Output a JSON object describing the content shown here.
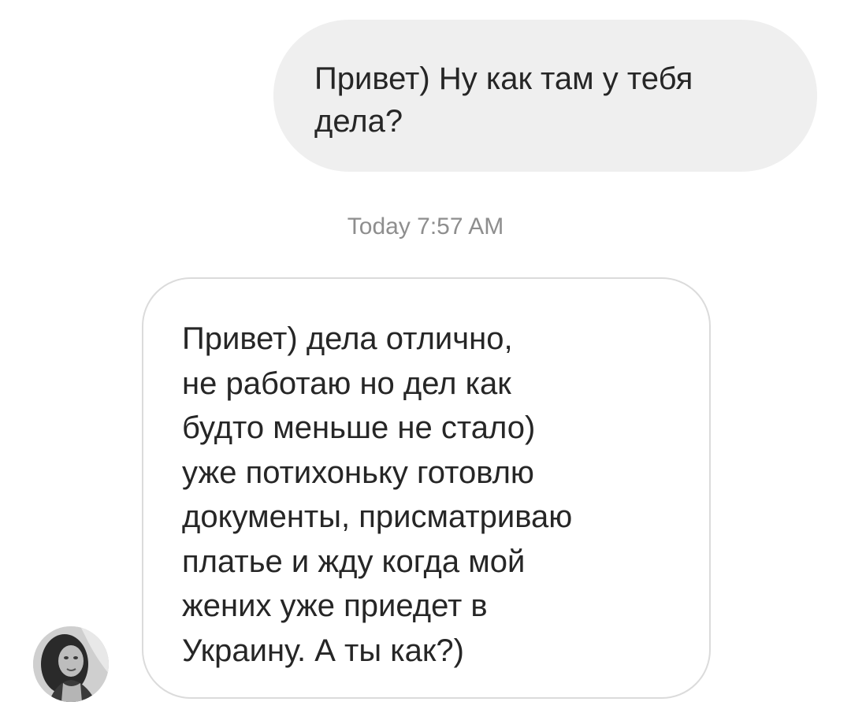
{
  "conversation": {
    "messages": [
      {
        "direction": "sent",
        "text": "Привет) Ну как там у тебя\nдела?"
      },
      {
        "direction": "received",
        "text": "Привет) дела отлично,\nне работаю но дел как\nбудто меньше не стало)\nуже потихоньку готовлю\nдокументы, присматриваю\nплатье и жду когда мой\nжених уже приедет в\nУкраину. А ты как?)"
      }
    ],
    "timestamp": "Today 7:57 AM"
  },
  "contact": {
    "avatar_icon": "profile-photo-avatar"
  },
  "colors": {
    "sent_bubble_bg": "#efefef",
    "received_bubble_border": "#dbdbdb",
    "text": "#262626",
    "timestamp": "#8e8e8e"
  }
}
